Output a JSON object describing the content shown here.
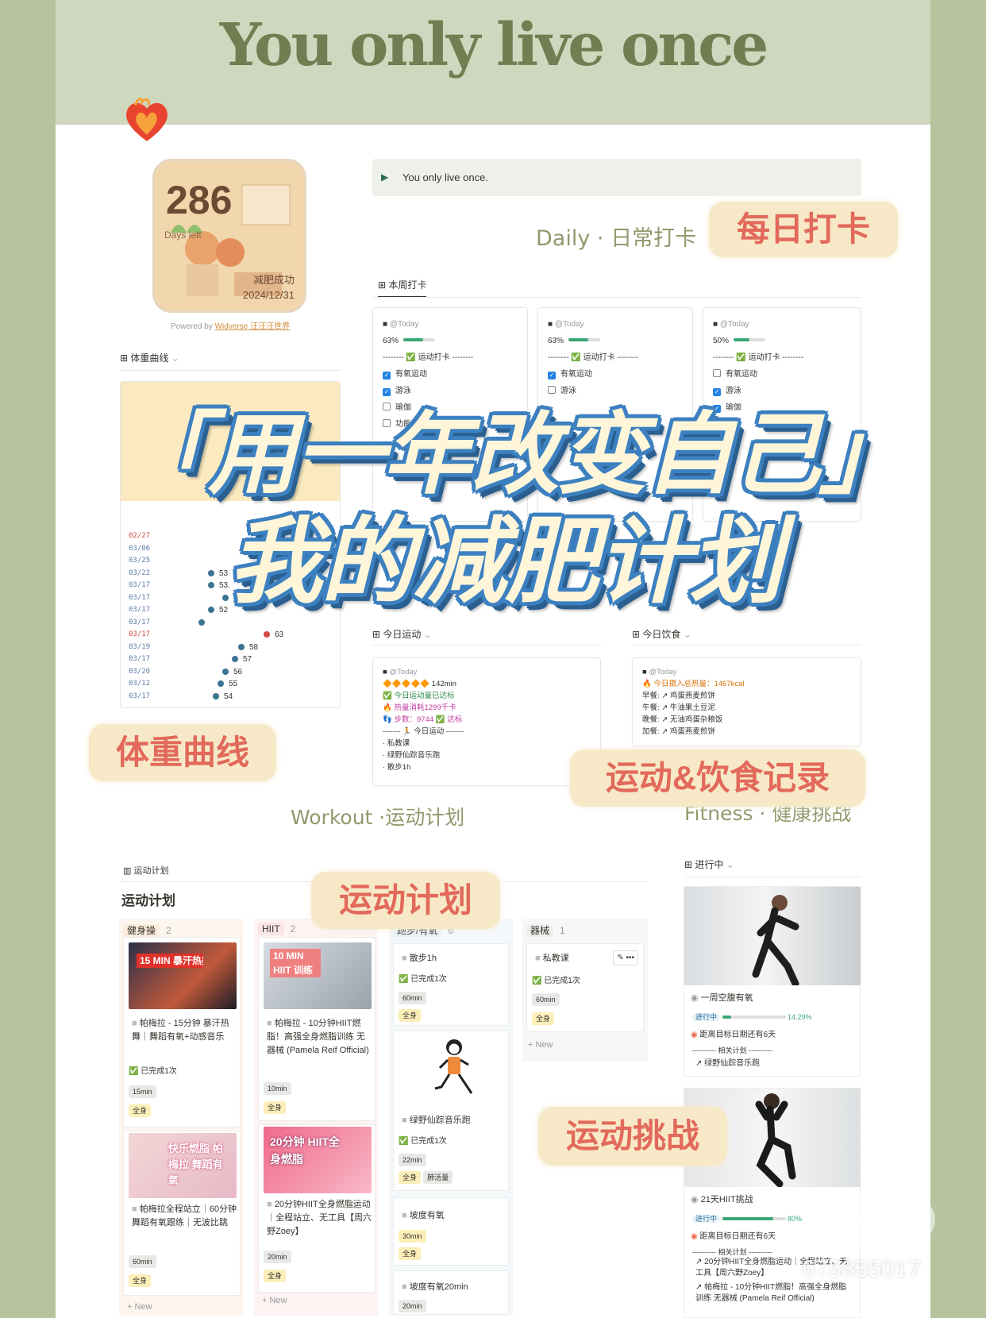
{
  "hero": {
    "title": "You only live once"
  },
  "countdown": {
    "days": "286",
    "days_label": "Days left",
    "goal": "减肥成功",
    "date": "2024/12/31",
    "powered_prefix": "Powered by",
    "powered_link": "Widverse 汪汪汪世界"
  },
  "callout": {
    "text": "You only live once."
  },
  "daily": {
    "heading": "Daily · 日常打卡",
    "tab": "本周打卡",
    "cards": [
      {
        "title": "@Today",
        "percent": "63%",
        "progress": 0.63,
        "divider": "-------- ✅ 运动打卡 --------",
        "items": [
          {
            "label": "有氧运动",
            "checked": true
          },
          {
            "label": "游泳",
            "checked": true
          },
          {
            "label": "瑜伽",
            "checked": false
          },
          {
            "label": "功能",
            "checked": false
          }
        ]
      },
      {
        "title": "@Today",
        "percent": "63%",
        "progress": 0.63,
        "divider": "-------- ✅ 运动打卡 --------",
        "items": [
          {
            "label": "有氧运动",
            "checked": true
          },
          {
            "label": "游泳",
            "checked": false
          }
        ]
      },
      {
        "title": "@Today",
        "percent": "50%",
        "progress": 0.5,
        "divider": "-------- ✅ 运动打卡 --------",
        "items": [
          {
            "label": "有氧运动",
            "checked": false
          },
          {
            "label": "游泳",
            "checked": true
          },
          {
            "label": "瑜伽",
            "checked": true
          }
        ]
      }
    ]
  },
  "weight": {
    "tab": "体重曲线",
    "dates": [
      "02/27",
      "03/06",
      "03/25",
      "03/22",
      "03/17",
      "03/17",
      "03/17",
      "03/17",
      "03/17",
      "03/19",
      "03/17",
      "03/20",
      "03/12",
      "03/17"
    ],
    "values": [
      "53",
      "53.",
      "5",
      "52",
      "63",
      "58",
      "57",
      "56",
      "55",
      "54"
    ]
  },
  "today_workout": {
    "tab": "今日运动",
    "title": "@Today",
    "lines": [
      "🔶🔶🔶🔶🔶 142min",
      "✅ 今日运动量已达标",
      "🔥 热量消耗1299千卡",
      "👣 步数：9744 ✅ 达标",
      "------- 🏃 今日运动 -------",
      "· 私教课",
      "· 绿野仙踪音乐跑",
      "· 散步1h"
    ]
  },
  "today_diet": {
    "tab": "今日饮食",
    "title": "@Today",
    "lines": [
      "🔥 今日摄入总热量：1467kcal",
      "早餐: ↗ 鸡蛋燕麦煎饼",
      "午餐: ↗ 牛油果土豆泥",
      "晚餐: ↗ 无油鸡蛋杂粮饭",
      "加餐: ↗ 鸡蛋燕麦煎饼"
    ]
  },
  "workout": {
    "heading": "Workout ·运动计划",
    "tab": "运动计划",
    "title": "运动计划",
    "columns": [
      {
        "label": "健身操",
        "count": "2",
        "color": "#fbecdd",
        "cards": [
          {
            "thumb": "15 MIN 暴汗热舞",
            "title": "帕梅拉 - 15分钟 暴汗热舞｜舞蹈有氧+动感音乐",
            "done": "已完成1次",
            "time": "15min",
            "tags": [
              "全身"
            ]
          },
          {
            "thumb": "快乐燃脂 帕梅拉 舞蹈有氧",
            "title": "帕梅拉全程站立｜60分钟舞蹈有氧跟练｜无波比跳",
            "done": "",
            "time": "60min",
            "tags": [
              "全身"
            ]
          }
        ]
      },
      {
        "label": "HIIT",
        "count": "2",
        "color": "#fbe4e4",
        "cards": [
          {
            "thumb": "10 MIN HIIT 训练",
            "title": "帕梅拉 - 10分钟HIIT燃脂！高强全身燃脂训练 无器械 (Pamela Reif Official)",
            "done": "",
            "time": "10min",
            "tags": [
              "全身"
            ]
          },
          {
            "thumb": "20分钟 HIIT全身燃脂",
            "title": "20分钟HIIT全身燃脂运动｜全程站立、无工具【周六野Zoey】",
            "done": "",
            "time": "20min",
            "tags": [
              "全身"
            ]
          }
        ]
      },
      {
        "label": "跑步/有氧",
        "count": "6",
        "color": "#e7f3f8",
        "cards": [
          {
            "thumb": "",
            "title": "散步1h",
            "done": "已完成1次",
            "time": "60min",
            "tags": [
              "全身"
            ]
          },
          {
            "thumb": "",
            "title": "绿野仙踪音乐跑",
            "done": "已完成1次",
            "time": "22min",
            "tags": [
              "全身",
              "肺活量"
            ]
          },
          {
            "thumb": "",
            "title": "坡度有氧",
            "done": "",
            "time": "30min",
            "tags": [
              "全身"
            ]
          },
          {
            "thumb": "",
            "title": "坡度有氧20min",
            "done": "",
            "time": "20min",
            "tags": []
          }
        ]
      },
      {
        "label": "器械",
        "count": "1",
        "color": "#eeeeec",
        "cards": [
          {
            "thumb": "",
            "title": "私教课",
            "done": "已完成1次",
            "time": "60min",
            "tags": [
              "全身"
            ]
          }
        ]
      }
    ],
    "new_label": "+ New"
  },
  "fitness": {
    "heading": "Fitness · 健康挑战",
    "tab": "进行中",
    "cards": [
      {
        "title": "一周空腹有氧",
        "status": "进行中",
        "percent": "14.29%",
        "progress": 0.1429,
        "remain": "距离目标日期还有6天",
        "related": "---------- 相关计划 ----------",
        "plans": [
          "绿野仙踪音乐跑"
        ]
      },
      {
        "title": "21天HIIT挑战",
        "status": "进行中",
        "percent": "80%",
        "progress": 0.8,
        "remain": "距离目标日期还有6天",
        "related": "---------- 相关计划 ----------",
        "plans": [
          "20分钟HIIT全身燃脂运动｜全程站立、无工具【周六野Zoey】",
          "帕梅拉 - 10分钟HIIT燃脂！高强全身燃脂训练 无器械 (Pamela Reif Official)"
        ]
      }
    ]
  },
  "overlay": {
    "line1": "「用一年改变自己」",
    "line2": "我的减肥计划",
    "sticker_daily": "每日打卡",
    "sticker_weight": "体重曲线",
    "sticker_record": "运动&饮食记录",
    "sticker_plan": "运动计划",
    "sticker_challenge": "运动挑战"
  },
  "watermark": {
    "id": "675855017",
    "logo": "小红书"
  },
  "colors": {
    "accent": "#8f9a6d",
    "sticker_text": "#e2695b",
    "sticker_bg": "#f7e9c7",
    "overlay_stroke": "#3c80c0"
  }
}
